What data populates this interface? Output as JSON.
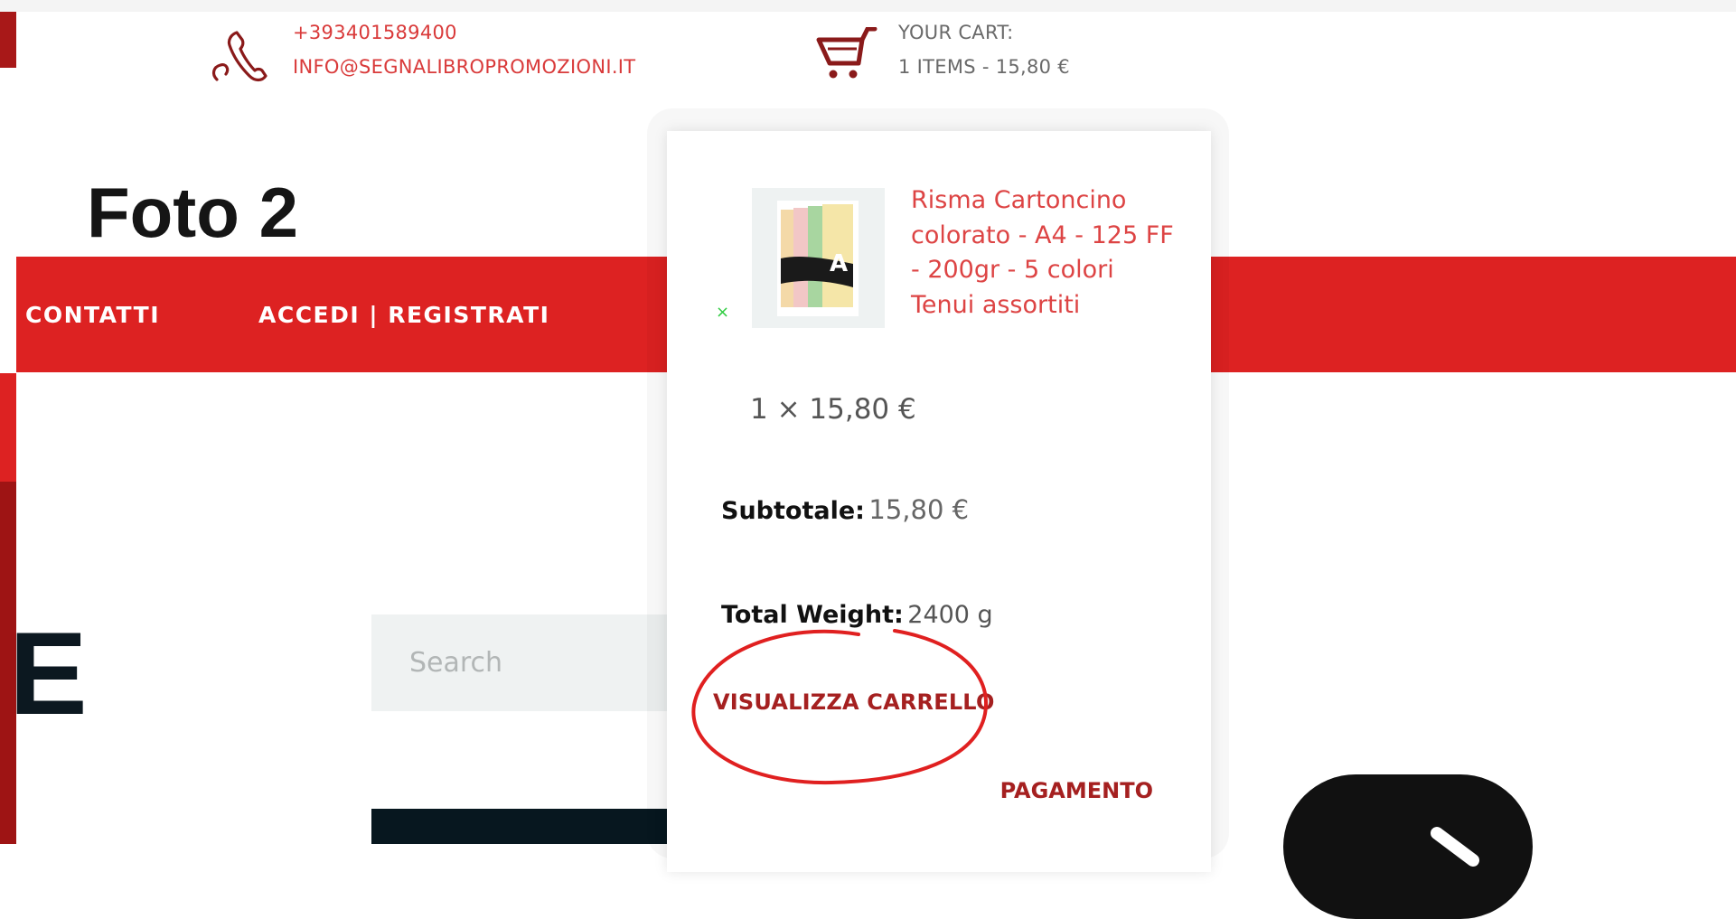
{
  "header": {
    "phone": "+393401589400",
    "email": "INFO@SEGNALIBROPROMOZIONI.IT",
    "cart_label": "YOUR CART:",
    "cart_summary": "1 ITEMS - 15,80 €"
  },
  "annotation": {
    "label": "Foto 2"
  },
  "nav": {
    "items": [
      {
        "label": "CONTATTI"
      },
      {
        "label": "ACCEDI | REGISTRATI"
      }
    ]
  },
  "hero": {
    "letter": "E"
  },
  "search": {
    "placeholder": "Search"
  },
  "cart_dropdown": {
    "remove_symbol": "×",
    "item": {
      "name": "Risma Cartoncino colorato - A4 - 125 FF - 200gr - 5 colori Tenui assortiti",
      "quantity_price": "1 × 15,80 €"
    },
    "subtotal_label": "Subtotale:",
    "subtotal_value": "15,80 €",
    "weight_label": "Total Weight:",
    "weight_value": "2400 g",
    "view_cart_label": "VISUALIZZA CARRELLO",
    "checkout_label": "PAGAMENTO"
  },
  "colors": {
    "nav_red": "#dd2222",
    "link_red": "#a52020",
    "annotation_circle": "#e02020"
  },
  "icons": {
    "phone": "phone-icon",
    "cart": "cart-icon",
    "arrow": "chevron-right-icon"
  }
}
